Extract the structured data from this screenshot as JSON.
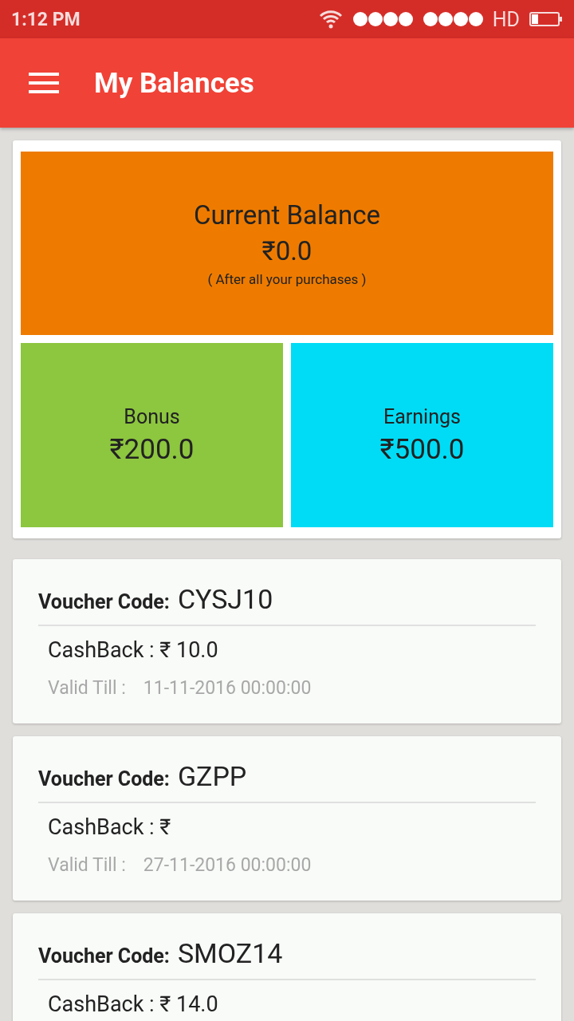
{
  "status_bar": {
    "time": "1:12 PM",
    "network": "HD"
  },
  "app_bar": {
    "title": "My Balances"
  },
  "current_balance": {
    "label": "Current Balance",
    "amount": "₹0.0",
    "note": "( After all your purchases )"
  },
  "tiles": [
    {
      "label": "Bonus",
      "amount": "₹200.0",
      "color": "#8dc63f"
    },
    {
      "label": "Earnings",
      "amount": "₹500.0",
      "color": "#00dcf5"
    }
  ],
  "vouchers": [
    {
      "code_label": "Voucher Code:",
      "code": "CYSJ10",
      "cashback": "CashBack :  ₹ 10.0",
      "valid_label": "Valid Till :",
      "valid_till": "11-11-2016 00:00:00"
    },
    {
      "code_label": "Voucher Code:",
      "code": "GZPP",
      "cashback": "CashBack :  ₹",
      "valid_label": "Valid Till :",
      "valid_till": "27-11-2016 00:00:00"
    },
    {
      "code_label": "Voucher Code:",
      "code": "SMOZ14",
      "cashback": "CashBack :  ₹ 14.0"
    }
  ]
}
